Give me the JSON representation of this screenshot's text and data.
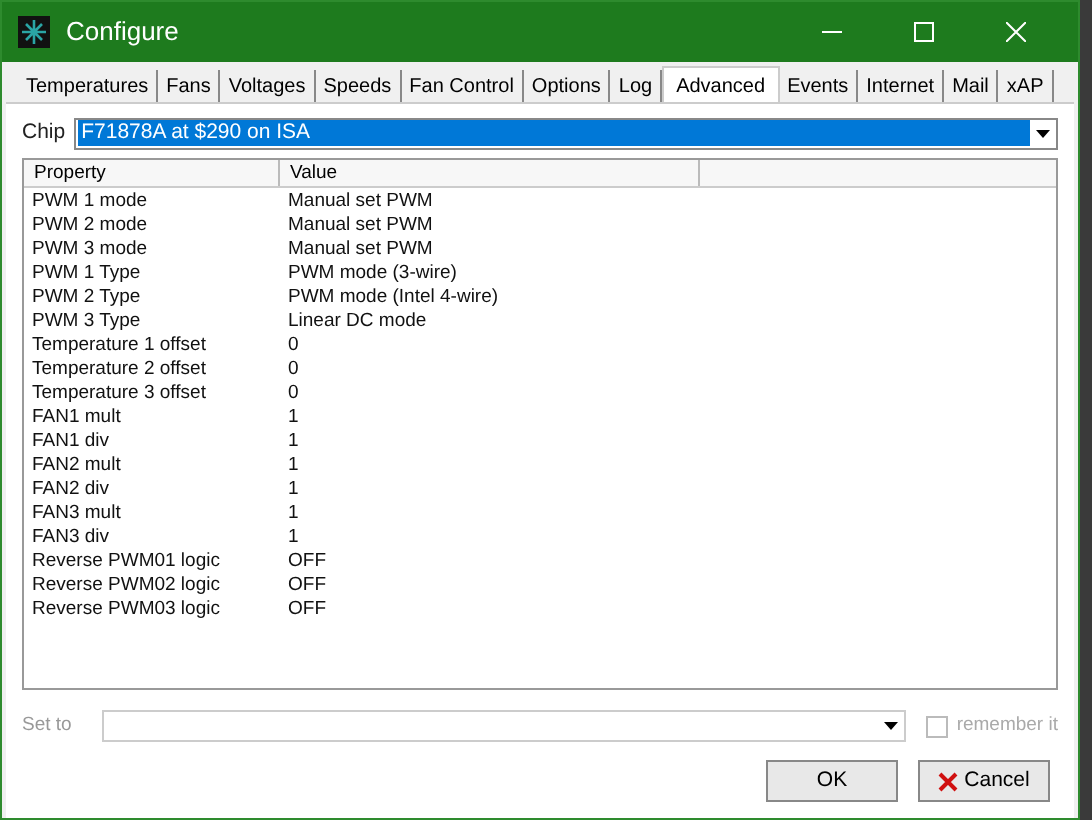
{
  "window": {
    "title": "Configure"
  },
  "tabs": [
    {
      "label": "Temperatures",
      "selected": false
    },
    {
      "label": "Fans",
      "selected": false
    },
    {
      "label": "Voltages",
      "selected": false
    },
    {
      "label": "Speeds",
      "selected": false
    },
    {
      "label": "Fan Control",
      "selected": false
    },
    {
      "label": "Options",
      "selected": false
    },
    {
      "label": "Log",
      "selected": false
    },
    {
      "label": "Advanced",
      "selected": true
    },
    {
      "label": "Events",
      "selected": false
    },
    {
      "label": "Internet",
      "selected": false
    },
    {
      "label": "Mail",
      "selected": false
    },
    {
      "label": "xAP",
      "selected": false
    }
  ],
  "chip": {
    "label": "Chip",
    "value": "F71878A at $290 on ISA"
  },
  "table": {
    "columns": [
      "Property",
      "Value"
    ],
    "rows": [
      [
        "PWM 1 mode",
        "Manual set PWM"
      ],
      [
        "PWM 2 mode",
        "Manual set PWM"
      ],
      [
        "PWM 3 mode",
        "Manual set PWM"
      ],
      [
        "PWM 1 Type",
        "PWM mode (3-wire)"
      ],
      [
        "PWM 2 Type",
        "PWM mode (Intel 4-wire)"
      ],
      [
        "PWM 3 Type",
        "Linear DC mode"
      ],
      [
        "Temperature 1 offset",
        "0"
      ],
      [
        "Temperature 2 offset",
        "0"
      ],
      [
        "Temperature 3 offset",
        "0"
      ],
      [
        "FAN1 mult",
        "1"
      ],
      [
        "FAN1 div",
        "1"
      ],
      [
        "FAN2 mult",
        "1"
      ],
      [
        "FAN2 div",
        "1"
      ],
      [
        "FAN3 mult",
        "1"
      ],
      [
        "FAN3 div",
        "1"
      ],
      [
        "Reverse PWM01 logic",
        "OFF"
      ],
      [
        "Reverse PWM02 logic",
        "OFF"
      ],
      [
        "Reverse PWM03 logic",
        "OFF"
      ]
    ]
  },
  "set_to": {
    "label": "Set to",
    "disabled": true
  },
  "remember": {
    "label": "remember it",
    "checked": false,
    "disabled": true
  },
  "buttons": [
    {
      "label": "OK",
      "kind": "ok"
    },
    {
      "label": "Cancel",
      "kind": "cancel"
    }
  ]
}
